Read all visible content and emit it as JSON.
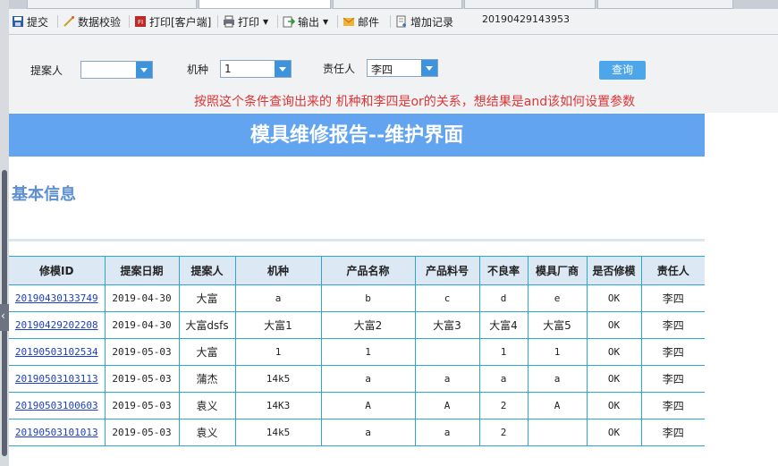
{
  "toolbar": {
    "items": [
      {
        "label": "提交",
        "icon": "save-icon"
      },
      {
        "label": "数据校验",
        "icon": "validate-icon"
      },
      {
        "label": "打印[客户端]",
        "icon": "print-client-icon"
      },
      {
        "label": "打印",
        "icon": "printer-icon"
      },
      {
        "label": "输出",
        "icon": "export-icon"
      },
      {
        "label": "邮件",
        "icon": "mail-icon"
      },
      {
        "label": "增加记录",
        "icon": "add-record-icon"
      }
    ],
    "doc_number": "20190429143953"
  },
  "query": {
    "proposer_label": "提案人",
    "proposer_value": "",
    "machine_label": "机种",
    "machine_value": "1",
    "owner_label": "责任人",
    "owner_value": "李四",
    "button_label": "查询",
    "note": "按照这个条件查询出来的 机种和李四是or的关系，想结果是and该如何设置参数"
  },
  "page": {
    "title": "模具维修报告--维护界面",
    "section": "基本信息"
  },
  "table": {
    "headers": [
      "修模ID",
      "提案日期",
      "提案人",
      "机种",
      "产品名称",
      "产品料号",
      "不良率",
      "模具厂商",
      "是否修模",
      "责任人"
    ],
    "rows": [
      [
        "20190430133749",
        "2019-04-30",
        "大富",
        "a",
        "b",
        "c",
        "d",
        "e",
        "OK",
        "李四"
      ],
      [
        "20190429202208",
        "2019-04-30",
        "大富dsfs",
        "大富1",
        "大富2",
        "大富3",
        "大富4",
        "大富5",
        "OK",
        "李四"
      ],
      [
        "20190503102534",
        "2019-05-03",
        "大富",
        "1",
        "1",
        "",
        "1",
        "1",
        "OK",
        "李四"
      ],
      [
        "20190503103113",
        "2019-05-03",
        "蒲杰",
        "14k5",
        "a",
        "a",
        "a",
        "a",
        "OK",
        "李四"
      ],
      [
        "20190503100603",
        "2019-05-03",
        "袁义",
        "14K3",
        "A",
        "A",
        "2",
        "A",
        "OK",
        "李四"
      ],
      [
        "20190503101013",
        "2019-05-03",
        "袁义",
        "14k5",
        "a",
        "a",
        "2",
        "",
        "OK",
        "李四"
      ]
    ]
  },
  "colors": {
    "banner": "#62a4f0",
    "note": "#e03434",
    "link": "#1a3ec8",
    "grid_border": "#2aa6d8"
  }
}
